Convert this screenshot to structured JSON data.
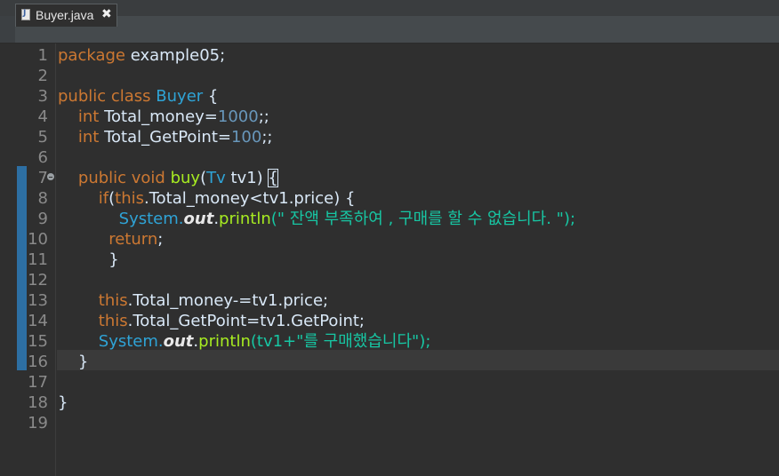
{
  "tab": {
    "icon": "java-file-icon",
    "title": "Buyer.java",
    "close": "✖"
  },
  "editor": {
    "line_numbers": [
      "1",
      "2",
      "3",
      "4",
      "5",
      "6",
      "7",
      "8",
      "9",
      "10",
      "11",
      "12",
      "13",
      "14",
      "15",
      "16",
      "17",
      "18",
      "19"
    ],
    "lines": [
      [
        {
          "t": "package",
          "c": "kw"
        },
        {
          "t": " example05;",
          "c": "pl"
        }
      ],
      [],
      [
        {
          "t": "public class ",
          "c": "kw"
        },
        {
          "t": "Buyer",
          "c": "cls"
        },
        {
          "t": " {",
          "c": "pl"
        }
      ],
      [
        {
          "t": "    ",
          "c": "pl"
        },
        {
          "t": "int",
          "c": "kw"
        },
        {
          "t": " Total_money=",
          "c": "pl"
        },
        {
          "t": "1000",
          "c": "num"
        },
        {
          "t": ";;",
          "c": "pl"
        }
      ],
      [
        {
          "t": "    ",
          "c": "pl"
        },
        {
          "t": "int",
          "c": "kw"
        },
        {
          "t": " Total_GetPoint=",
          "c": "pl"
        },
        {
          "t": "100",
          "c": "num"
        },
        {
          "t": ";;",
          "c": "pl"
        }
      ],
      [],
      [
        {
          "t": "    ",
          "c": "pl"
        },
        {
          "t": "public void ",
          "c": "kw"
        },
        {
          "t": "buy",
          "c": "mth"
        },
        {
          "t": "(",
          "c": "pl"
        },
        {
          "t": "Tv",
          "c": "cls"
        },
        {
          "t": " tv1) ",
          "c": "pl"
        },
        {
          "t": "{",
          "c": "pl bracket"
        }
      ],
      [
        {
          "t": "        ",
          "c": "pl"
        },
        {
          "t": "if",
          "c": "kw"
        },
        {
          "t": "(",
          "c": "pl"
        },
        {
          "t": "this",
          "c": "kw"
        },
        {
          "t": ".Total_money<tv1.price) {",
          "c": "pl"
        }
      ],
      [
        {
          "t": "            ",
          "c": "pl"
        },
        {
          "t": "System.",
          "c": "sys"
        },
        {
          "t": "out",
          "c": "fld"
        },
        {
          "t": ".",
          "c": "pl"
        },
        {
          "t": "println",
          "c": "mth"
        },
        {
          "t": "(\" 잔액 부족하여 , 구매를 할 수 없습니다. \");",
          "c": "str"
        }
      ],
      [
        {
          "t": "          ",
          "c": "pl"
        },
        {
          "t": "return",
          "c": "kw"
        },
        {
          "t": ";",
          "c": "pl"
        }
      ],
      [
        {
          "t": "          }",
          "c": "pl"
        }
      ],
      [],
      [
        {
          "t": "        ",
          "c": "pl"
        },
        {
          "t": "this",
          "c": "kw"
        },
        {
          "t": ".Total_money-=tv1.price;",
          "c": "pl"
        }
      ],
      [
        {
          "t": "        ",
          "c": "pl"
        },
        {
          "t": "this",
          "c": "kw"
        },
        {
          "t": ".Total_GetPoint=tv1.GetPoint;",
          "c": "pl"
        }
      ],
      [
        {
          "t": "        ",
          "c": "pl"
        },
        {
          "t": "System.",
          "c": "sys"
        },
        {
          "t": "out",
          "c": "fld"
        },
        {
          "t": ".",
          "c": "pl"
        },
        {
          "t": "println",
          "c": "mth"
        },
        {
          "t": "(tv1+\"를 구매했습니다\");",
          "c": "str"
        }
      ],
      [
        {
          "t": "    }",
          "c": "pl"
        }
      ],
      [],
      [
        {
          "t": "}",
          "c": "pl"
        }
      ],
      []
    ]
  },
  "colors": {
    "background": "#2f2f2f",
    "keyword": "#cc7832",
    "plain": "#d9e8f7",
    "class": "#2fa3d6",
    "number": "#6897bb",
    "method": "#a7ec21",
    "string": "#17c6a3",
    "line_number": "#8a8a8a",
    "change_bar": "#2d6fa3",
    "current_line": "#3a3a3a"
  }
}
